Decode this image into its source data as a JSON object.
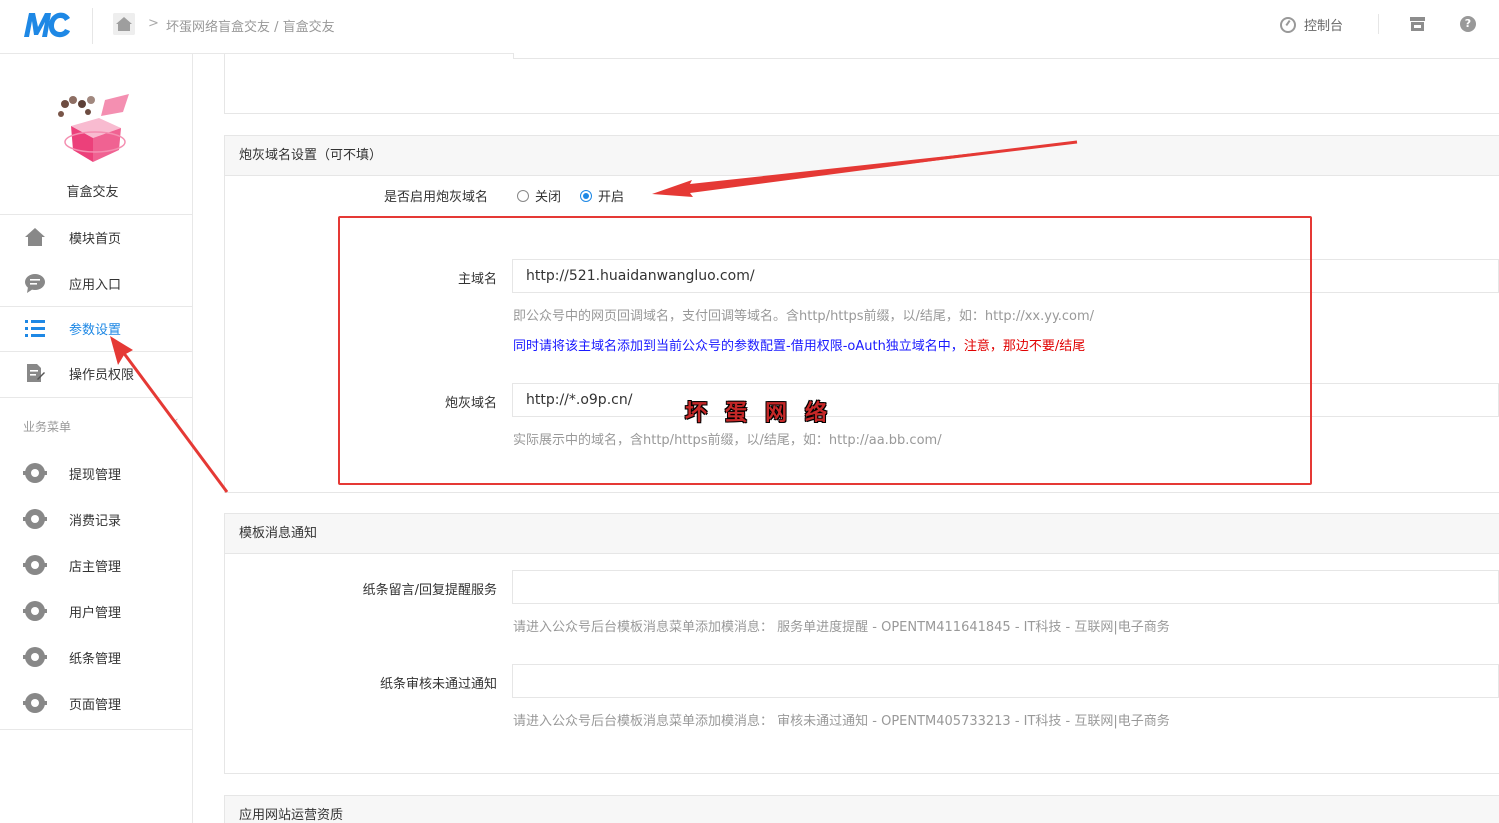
{
  "header": {
    "logo_text": "MC",
    "breadcrumb": "坏蛋网络盲盒交友 / 盲盒交友",
    "console_label": "控制台"
  },
  "sidebar": {
    "app_name": "盲盒交友",
    "menu": [
      {
        "label": "模块首页",
        "icon": "home-icon"
      },
      {
        "label": "应用入口",
        "icon": "chat-icon"
      },
      {
        "label": "参数设置",
        "icon": "list-icon",
        "active": true
      },
      {
        "label": "操作员权限",
        "icon": "edit-icon"
      }
    ],
    "group_title": "业务菜单",
    "business_menu": [
      {
        "label": "提现管理",
        "icon": "gear-icon"
      },
      {
        "label": "消费记录",
        "icon": "gear-icon"
      },
      {
        "label": "店主管理",
        "icon": "gear-icon"
      },
      {
        "label": "用户管理",
        "icon": "gear-icon"
      },
      {
        "label": "纸条管理",
        "icon": "gear-icon"
      },
      {
        "label": "页面管理",
        "icon": "gear-icon"
      }
    ]
  },
  "cannon_section": {
    "title": "炮灰域名设置（可不填）",
    "enable_label": "是否启用炮灰域名",
    "option_off": "关闭",
    "option_on": "开启",
    "selected": "开启",
    "main_domain_label": "主域名",
    "main_domain_value": "http://521.huaidanwangluo.com/",
    "main_domain_help": "即公众号中的网页回调域名，支付回调等域名。含http/https前缀，以/结尾，如：http://xx.yy.com/",
    "main_domain_note_blue": "同时请将该主域名添加到当前公众号的参数配置-借用权限-oAuth独立域名中，",
    "main_domain_note_red": "注意，那边不要/结尾",
    "cannon_domain_label": "炮灰域名",
    "cannon_domain_value": "http://*.o9p.cn/",
    "cannon_domain_help": "实际展示中的域名，含http/https前缀，以/结尾，如：http://aa.bb.com/",
    "watermark": "坏蛋网络"
  },
  "template_section": {
    "title": "模板消息通知",
    "field1_label": "纸条留言/回复提醒服务",
    "field1_help": "请进入公众号后台模板消息菜单添加模消息：  服务单进度提醒 - OPENTM411641845 - IT科技 - 互联网|电子商务",
    "field2_label": "纸条审核未通过通知",
    "field2_help": "请进入公众号后台模板消息菜单添加模消息：  审核未通过通知 - OPENTM405733213 - IT科技 - 互联网|电子商务"
  },
  "next_section": {
    "title": "应用网站运营资质"
  },
  "colors": {
    "accent": "#1e88e5",
    "annotation_red": "#e53935",
    "note_blue": "#1a1aff",
    "note_red": "#e00000"
  }
}
